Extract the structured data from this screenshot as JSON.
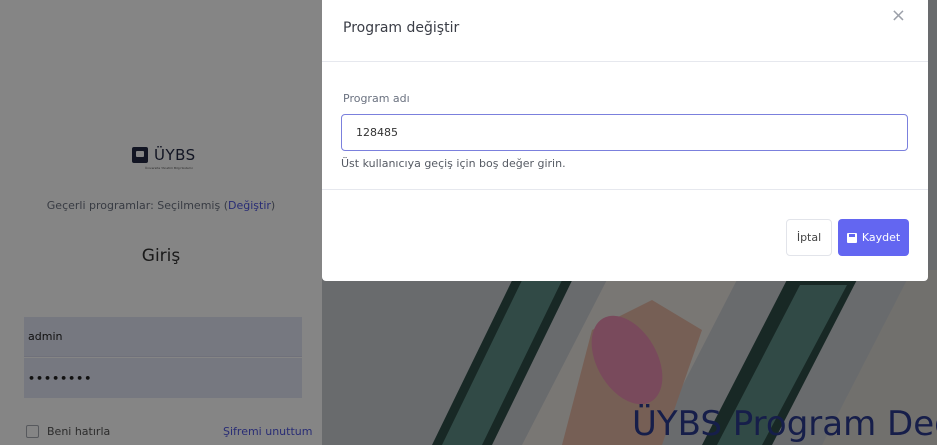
{
  "login": {
    "logo_text": "ÜYBS",
    "logo_tagline": "Üniversite Yönetim Bilgi Sistemi",
    "program_prefix": "Geçerli programlar: Seçilmemiş (",
    "program_link": "Değiştir",
    "program_suffix": ")",
    "title": "Giriş",
    "username_value": "admin",
    "password_value": "••••••••",
    "remember_label": "Beni hatırla",
    "forgot_label": "Şifremi unuttum"
  },
  "hero": {
    "title": "ÜYBS Program Değ"
  },
  "modal": {
    "title": "Program değiştir",
    "close_label": "×",
    "field_label": "Program adı",
    "field_value": "128485",
    "help_text": "Üst kullanıcıya geçiş için boş değer girin.",
    "cancel_label": "İptal",
    "save_label": "Kaydet"
  },
  "colors": {
    "accent": "#6366f1",
    "link": "#4f56e0",
    "backdrop": "rgba(0,0,0,0.48)"
  },
  "icons": {
    "logo": "uybs-logo-icon",
    "save": "floppy-disk-icon",
    "close": "close-icon"
  }
}
